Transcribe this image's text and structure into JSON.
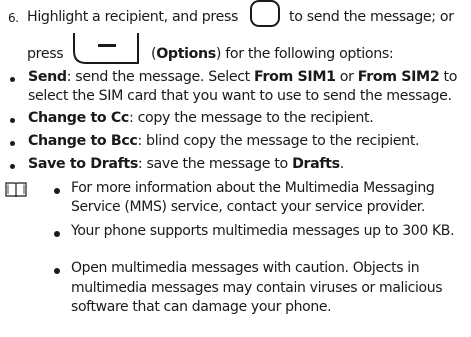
{
  "step": {
    "number": "6.",
    "line1_a": "Highlight a recipient, and press",
    "line1_b": "to send the message; or",
    "line2_a": "press",
    "options_word": "Options",
    "line2_b": "for the following options:",
    "center_key_icon": "center-key-icon",
    "left-soft-key-icon": "left-soft-key-icon"
  },
  "options": [
    {
      "term": "Send",
      "desc_a": ": send the message. Select ",
      "sim1": "From SIM1",
      "desc_or": " or ",
      "sim2": "From SIM2",
      "desc_b": " to",
      "desc_line2": "select the SIM card that you want to use to send the message."
    },
    {
      "term": "Change to Cc",
      "desc": ": copy the message to the recipient."
    },
    {
      "term": "Change to Bcc",
      "desc": ": blind copy the message to the recipient."
    },
    {
      "term": "Save to Drafts",
      "desc_a": ": save the message to ",
      "drafts": "Drafts",
      "desc_b": "."
    }
  ],
  "notes": {
    "icon": "book-icon",
    "items": [
      {
        "line1": "For more information about the Multimedia Messaging",
        "line2": "Service (MMS) service, contact your service provider."
      },
      {
        "line1": "Your phone supports multimedia messages up to 300 KB."
      },
      {
        "line1": "Open multimedia messages with caution. Objects in",
        "line2": "multimedia messages may contain viruses or malicious",
        "line3": "software that can damage your phone."
      }
    ]
  }
}
